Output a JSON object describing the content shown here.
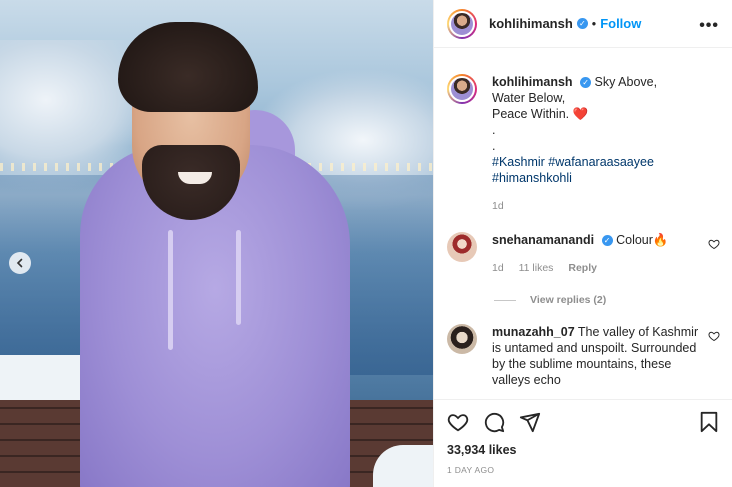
{
  "header": {
    "username": "kohlihimansh",
    "follow_label": "Follow",
    "more_label": "•••"
  },
  "caption": {
    "username": "kohlihimansh",
    "line1": "Sky Above,",
    "line2": "Water Below,",
    "line3": "Peace Within.",
    "heart": "❤️",
    "dot1": ".",
    "dot2": ".",
    "hashtags_line1": "#Kashmir #wafanaraasaayee",
    "hashtags_line2": "#himanshkohli",
    "age": "1d"
  },
  "comments": [
    {
      "username": "snehanamanandi",
      "text": "Colour🔥",
      "age": "1d",
      "likes": "11 likes",
      "reply_label": "Reply",
      "view_replies": "View replies (2)"
    },
    {
      "username": "munazahh_07",
      "text": "The valley of Kashmir is untamed and unspoilt. Surrounded by the sublime mountains, these valleys echo"
    }
  ],
  "footer": {
    "likes": "33,934 likes",
    "timestamp": "1 DAY AGO"
  },
  "icons": {
    "prev": "chevron-left-icon",
    "like": "heart-icon",
    "comment": "comment-icon",
    "share": "share-icon",
    "save": "bookmark-icon"
  },
  "colors": {
    "accent": "#0095f6",
    "verified": "#3897f0",
    "hashtag": "#00376b",
    "muted": "#8e8e8e"
  }
}
